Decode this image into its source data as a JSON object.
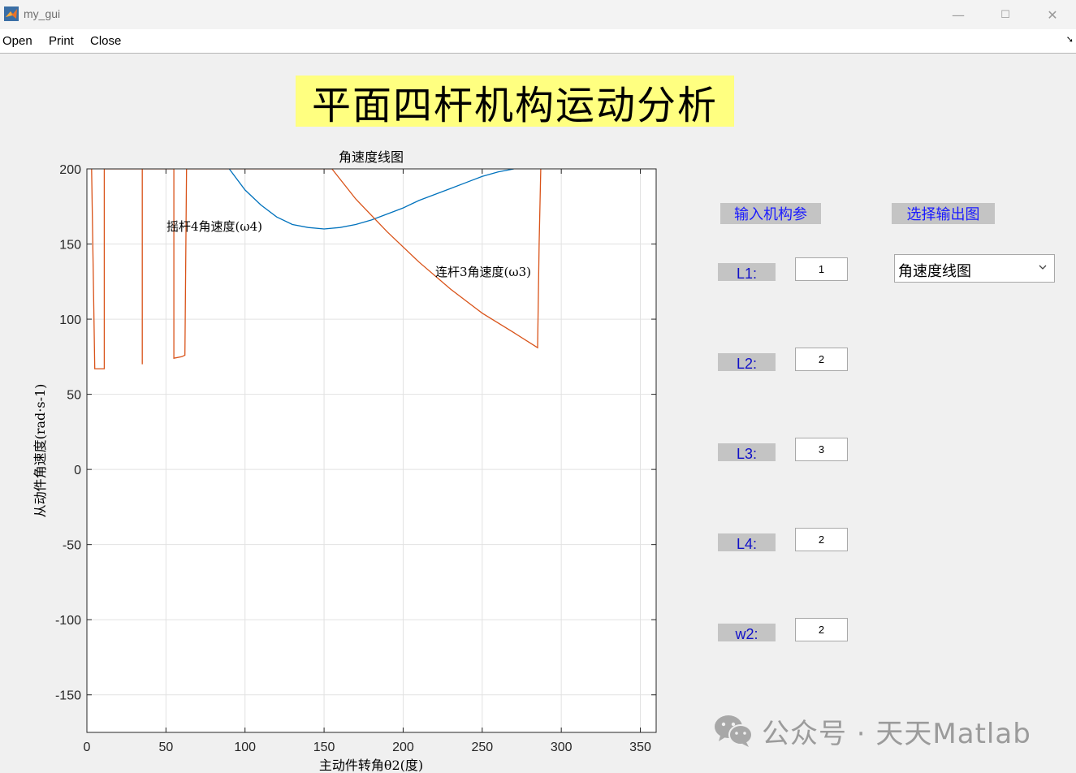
{
  "window": {
    "title": "my_gui",
    "minimize": "—",
    "maximize": "☐",
    "close": "✕"
  },
  "menu": {
    "items": [
      "Open",
      "Print",
      "Close"
    ],
    "corner_glyph": "➘"
  },
  "main_title": "平面四杆机构运动分析",
  "params": {
    "section_label": "输入机构参",
    "fields": [
      {
        "label": "L1:",
        "value": "1"
      },
      {
        "label": "L2:",
        "value": "2"
      },
      {
        "label": "L3:",
        "value": "3"
      },
      {
        "label": "L4:",
        "value": "2"
      },
      {
        "label": "w2:",
        "value": "2"
      }
    ]
  },
  "output": {
    "section_label": "选择输出图",
    "selected": "角速度线图"
  },
  "watermark": {
    "text": "公众号 · 天天Matlab"
  },
  "colors": {
    "series_w4": "#0072bd",
    "series_w3": "#d95319",
    "title_bg": "#ffff80",
    "label_bg": "#c4c4c4",
    "label_text": "#1a1aff"
  },
  "chart_data": {
    "type": "line",
    "title": "角速度线图",
    "xlabel": "主动件转角θ2(度)",
    "ylabel": "从动件角速度(rad·s-1)",
    "xlim": [
      0,
      360
    ],
    "ylim": [
      -175,
      200
    ],
    "xticks": [
      0,
      50,
      100,
      150,
      200,
      250,
      300,
      350
    ],
    "yticks": [
      -150,
      -100,
      -50,
      0,
      50,
      100,
      150,
      200
    ],
    "grid": true,
    "series": [
      {
        "name": "摇杆4角速度(ω4)",
        "x": [
          90,
          100,
          110,
          120,
          130,
          140,
          150,
          160,
          170,
          180,
          190,
          200,
          210,
          220,
          230,
          240,
          250,
          260,
          270
        ],
        "y": [
          200,
          186,
          176,
          168,
          163,
          161,
          160,
          161,
          163,
          166,
          170,
          174,
          179,
          183,
          187,
          191,
          195,
          198,
          200
        ]
      },
      {
        "name": "连杆3角速度(ω3)",
        "x": [
          3,
          5,
          10,
          11,
          11,
          35,
          35,
          35,
          35,
          55,
          55,
          60,
          62,
          63,
          155,
          170,
          190,
          210,
          230,
          250,
          270,
          285,
          286,
          287
        ],
        "y": [
          200,
          67,
          67,
          67,
          200,
          200,
          70,
          200,
          200,
          200,
          74,
          75,
          76,
          200,
          200,
          180,
          158,
          138,
          120,
          104,
          91,
          81,
          150,
          200
        ]
      }
    ],
    "annotations": [
      {
        "text": "摇杆4角速度(ω4)",
        "x": 50,
        "y": 160
      },
      {
        "text": "连杆3角速度(ω3)",
        "x": 220,
        "y": 130
      }
    ]
  }
}
